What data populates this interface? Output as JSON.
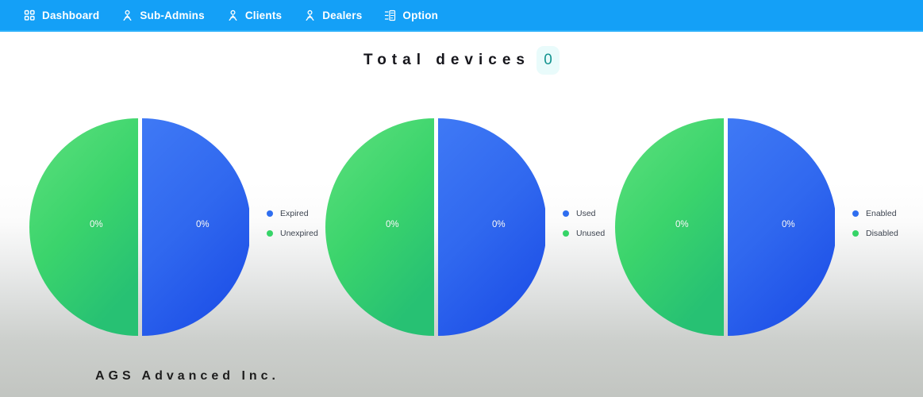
{
  "nav": {
    "items": [
      {
        "label": "Dashboard",
        "icon": "grid-icon",
        "active": true
      },
      {
        "label": "Sub-Admins",
        "icon": "person-icon",
        "active": false
      },
      {
        "label": "Clients",
        "icon": "person-icon",
        "active": false
      },
      {
        "label": "Dealers",
        "icon": "person-icon",
        "active": false
      },
      {
        "label": "Option",
        "icon": "list-icon",
        "active": false
      }
    ],
    "bar_color": "#14a0f7",
    "text_color": "#ffffff"
  },
  "header": {
    "title": "Total devices",
    "total_devices": "0",
    "badge_bg": "#e9fbfb",
    "badge_text_color": "#13938f"
  },
  "colors": {
    "blue": "#2f6ef0",
    "green": "#36d468",
    "label_text": "#ffffff"
  },
  "chart_data": [
    {
      "type": "pie",
      "title": "Expiry status",
      "slices": [
        {
          "name": "Expired",
          "value": 50,
          "label": "0%",
          "color": "#2f6ef0"
        },
        {
          "name": "Unexpired",
          "value": 50,
          "label": "0%",
          "color": "#36d468"
        }
      ],
      "legend": [
        {
          "label": "Expired",
          "color": "#2f6ef0"
        },
        {
          "label": "Unexpired",
          "color": "#36d468"
        }
      ],
      "legend_position": "right"
    },
    {
      "type": "pie",
      "title": "Usage status",
      "slices": [
        {
          "name": "Used",
          "value": 50,
          "label": "0%",
          "color": "#2f6ef0"
        },
        {
          "name": "Unused",
          "value": 50,
          "label": "0%",
          "color": "#36d468"
        }
      ],
      "legend": [
        {
          "label": "Used",
          "color": "#2f6ef0"
        },
        {
          "label": "Unused",
          "color": "#36d468"
        }
      ],
      "legend_position": "right"
    },
    {
      "type": "pie",
      "title": "Enable status",
      "slices": [
        {
          "name": "Enabled",
          "value": 50,
          "label": "0%",
          "color": "#2f6ef0"
        },
        {
          "name": "Disabled",
          "value": 50,
          "label": "0%",
          "color": "#36d468"
        }
      ],
      "legend": [
        {
          "label": "Enabled",
          "color": "#2f6ef0"
        },
        {
          "label": "Disabled",
          "color": "#36d468"
        }
      ],
      "legend_position": "right"
    }
  ],
  "footer": {
    "brand": "AGS Advanced Inc."
  }
}
